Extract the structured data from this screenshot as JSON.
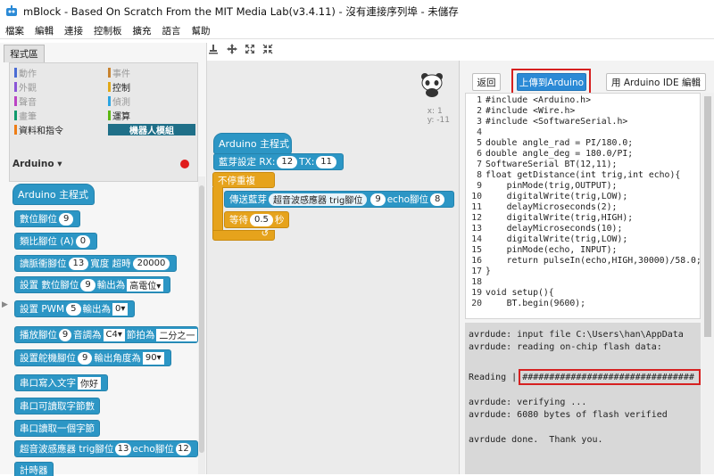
{
  "window": {
    "title": "mBlock - Based On Scratch From the MIT Media Lab(v3.4.11) - 沒有連接序列埠 - 未儲存"
  },
  "menu": [
    "檔案",
    "編輯",
    "連接",
    "控制板",
    "擴充",
    "語言",
    "幫助"
  ],
  "tabs": {
    "scripts": "程式區"
  },
  "categories": [
    {
      "label": "動作",
      "color": "#4a6cd4"
    },
    {
      "label": "事件",
      "color": "#c88330"
    },
    {
      "label": "外觀",
      "color": "#8a55d7"
    },
    {
      "label": "控制",
      "color": "#e1a91a"
    },
    {
      "label": "聲音",
      "color": "#bb42c3"
    },
    {
      "label": "偵測",
      "color": "#2ca5e2"
    },
    {
      "label": "畫筆",
      "color": "#0e9a6c"
    },
    {
      "label": "運算",
      "color": "#5cb712"
    },
    {
      "label": "資料和指令",
      "color": "#ee7d16"
    },
    {
      "label": "機器人模組",
      "color": "#1f6f88"
    }
  ],
  "palette": {
    "header": "Arduino ▾",
    "blocks": {
      "main": "Arduino 主程式",
      "digital_read": "數位腳位",
      "digital_read_v": "9",
      "analog_read": "類比腳位 (A)",
      "analog_read_v": "0",
      "pulse_a": "讀脈衝腳位",
      "pulse_v1": "13",
      "pulse_b": "寬度 超時",
      "pulse_v2": "20000",
      "set_digital_a": "設置 數位腳位",
      "set_digital_v1": "9",
      "set_digital_b": "輸出為",
      "set_digital_v2": "高電位▾",
      "pwm_a": "設置 PWM",
      "pwm_v1": "5",
      "pwm_b": "輸出為",
      "pwm_v2": "0▾",
      "tone_a": "播放腳位",
      "tone_v1": "9",
      "tone_b": "音調為",
      "tone_v2": "C4▾",
      "tone_c": "節拍為",
      "tone_v3": "二分之一",
      "servo_a": "設置舵機腳位",
      "servo_v1": "9",
      "servo_b": "輸出角度為",
      "servo_v2": "90▾",
      "serial_write": "串口寫入文字",
      "serial_write_v": "你好",
      "serial_available": "串口可讀取字節數",
      "serial_read": "串口讀取一個字節",
      "ultra_a": "超音波感應器 trig腳位",
      "ultra_v1": "13",
      "ultra_b": "echo腳位",
      "ultra_v2": "12",
      "timer": "計時器"
    }
  },
  "script": {
    "coords": {
      "x": "x: 1",
      "y": "y: -11"
    },
    "main": "Arduino 主程式",
    "bt_a": "藍芽設定 RX:",
    "bt_rx": "12",
    "bt_b": "TX:",
    "bt_tx": "11",
    "forever": "不停重複",
    "send_a": "傳送藍芽",
    "send_b": "超音波感應器 trig腳位",
    "send_trig": "9",
    "send_c": "echo腳位",
    "send_echo": "8",
    "wait_a": "等待",
    "wait_v": "0.5",
    "wait_b": "秒"
  },
  "ide": {
    "back": "返回",
    "upload": "上傳到Arduino",
    "edit_ide": "用 Arduino IDE 編輯"
  },
  "code": [
    {
      "n": "1",
      "t": "#include <Arduino.h>"
    },
    {
      "n": "2",
      "t": "#include <Wire.h>"
    },
    {
      "n": "3",
      "t": "#include <SoftwareSerial.h>"
    },
    {
      "n": "4",
      "t": ""
    },
    {
      "n": "5",
      "t": "double angle_rad = PI/180.0;"
    },
    {
      "n": "6",
      "t": "double angle_deg = 180.0/PI;"
    },
    {
      "n": "7",
      "t": "SoftwareSerial BT(12,11);"
    },
    {
      "n": "8",
      "t": "float getDistance(int trig,int echo){"
    },
    {
      "n": "9",
      "t": "    pinMode(trig,OUTPUT);"
    },
    {
      "n": "10",
      "t": "    digitalWrite(trig,LOW);"
    },
    {
      "n": "11",
      "t": "    delayMicroseconds(2);"
    },
    {
      "n": "12",
      "t": "    digitalWrite(trig,HIGH);"
    },
    {
      "n": "13",
      "t": "    delayMicroseconds(10);"
    },
    {
      "n": "14",
      "t": "    digitalWrite(trig,LOW);"
    },
    {
      "n": "15",
      "t": "    pinMode(echo, INPUT);"
    },
    {
      "n": "16",
      "t": "    return pulseIn(echo,HIGH,30000)/58.0;"
    },
    {
      "n": "17",
      "t": "}"
    },
    {
      "n": "18",
      "t": ""
    },
    {
      "n": "19",
      "t": "void setup(){"
    },
    {
      "n": "20",
      "t": "    BT.begin(9600);"
    }
  ],
  "console": [
    "avrdude: input file C:\\Users\\han\\AppData",
    "avrdude: reading on-chip flash data:",
    "",
    "Reading | ################################",
    "",
    "avrdude: verifying ...",
    "avrdude: 6080 bytes of flash verified",
    "",
    "avrdude done.  Thank you."
  ]
}
